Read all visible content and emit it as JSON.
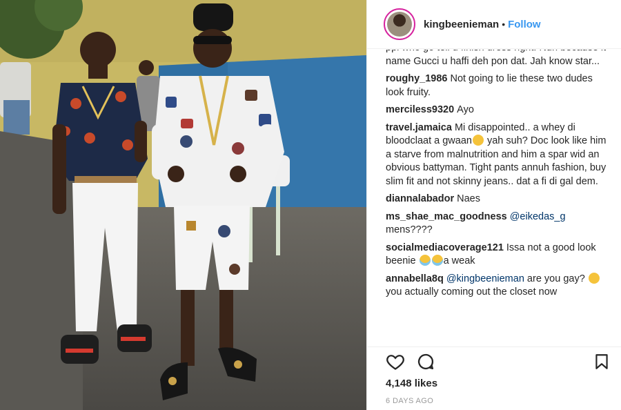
{
  "post": {
    "username": "kingbeenieman",
    "separator": "•",
    "follow_label": "Follow",
    "likes": "4,148 likes",
    "time_ago": "6 DAYS AGO",
    "accent_color": "#3897f0"
  },
  "comments": [
    {
      "user": "",
      "text": "ppl who go tell u finish dress right. Nuh because it name Gucci u haffi deh pon dat. Jah know star..."
    },
    {
      "user": "roughy_1986",
      "text": "Not going to lie these two dudes look fruity."
    },
    {
      "user": "merciless9320",
      "text": "Ayo"
    },
    {
      "user": "travel.jamaica",
      "text": "Mi disappointed.. a whey di bloodclaat a gwaan",
      "text2": " yah suh? Doc look like him a starve from malnutrition and him a spar wid an obvious battyman. Tight pants annuh fashion, buy slim fit and not skinny jeans.. dat a fi di gal dem."
    },
    {
      "user": "diannalabador",
      "text": "Naes"
    },
    {
      "user": "ms_shae_mac_goodness",
      "mention": "@eikedas_g",
      "text": "mens????"
    },
    {
      "user": "socialmediacoverage121",
      "text": "Issa not a good look beenie",
      "text2": "a weak"
    },
    {
      "user": "annabella8q",
      "mention": "@kingbeenieman",
      "text": "are you gay?",
      "text2": "you actually coming out the closet now"
    }
  ],
  "icons": [
    "avatar",
    "heart-icon",
    "comment-icon",
    "bookmark-icon",
    "smiley-emoji",
    "crying-emoji"
  ]
}
